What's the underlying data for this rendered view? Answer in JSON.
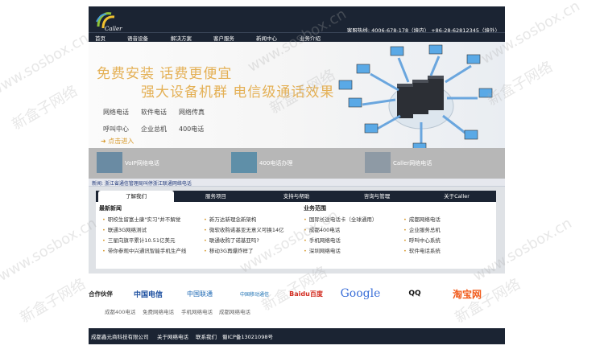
{
  "header": {
    "hotline": "客服热线: 4006-678-178（境内） +86-28-62812345（境外）",
    "logo_text": "Caller"
  },
  "nav": [
    "首页",
    "语音设备",
    "解决方案",
    "客户服务",
    "新闻中心",
    "业务介绍"
  ],
  "banner": {
    "slogan1": "免费安装  话费更便宜",
    "slogan2": "强大设备机群  电信级通话效果",
    "services_row1": [
      "网络电话",
      "软件电话",
      "网络传真"
    ],
    "services_row2": [
      "呼叫中心",
      "企业总机",
      "400电话"
    ],
    "enter_label": "点击进入",
    "thumbs": [
      "VoIP网络电话",
      "400电话办理",
      "Caller网络电话"
    ]
  },
  "notice": "新闻: 浙江省通信管理局叫停浙江联通网络电话",
  "tabs": [
    "了解我们",
    "服务项目",
    "支持与帮助",
    "咨询与管理",
    "关于Caller"
  ],
  "latest_news": {
    "title": "最新新闻",
    "col1": [
      "职校生留富士康\"实习\"并不解觉",
      "联通3G网络测试",
      "三星向旗平累计10.51亿美元",
      "带你参观中兴通讯智能手机生产线"
    ],
    "col2": [
      "新万达新理念新架构",
      "微软收购诺基亚无意义可换14亿",
      "联通收购了诺基亚吗?",
      "移动3G再爆炸样了"
    ]
  },
  "business": {
    "title": "业务范围",
    "col1": [
      "国际长途电话卡（全球通用）",
      "成都400电话",
      "手机网络电话",
      "深圳网络电话"
    ],
    "col2": [
      "成都网络电话",
      "企业服务总机",
      "呼叫中心系统",
      "软件电话系统"
    ]
  },
  "partners": {
    "label": "合作伙伴",
    "logos": [
      "中国电信",
      "中国联通",
      "中国移动通信",
      "Baidu百度",
      "Google",
      "QQ",
      "淘宝网"
    ],
    "links": [
      "成都400电话",
      "免费网络电话",
      "手机网络电话",
      "成都网络电话"
    ]
  },
  "footer": [
    "成都鑫元商科技有限公司",
    "关于网络电话",
    "联系我们",
    "蜀ICP备13021098号"
  ],
  "watermark": [
    "www.sosbox.cn",
    "新盒子网络"
  ],
  "colors": {
    "header": "#1b2433",
    "accent": "#e4b055",
    "link": "#223a7a"
  }
}
